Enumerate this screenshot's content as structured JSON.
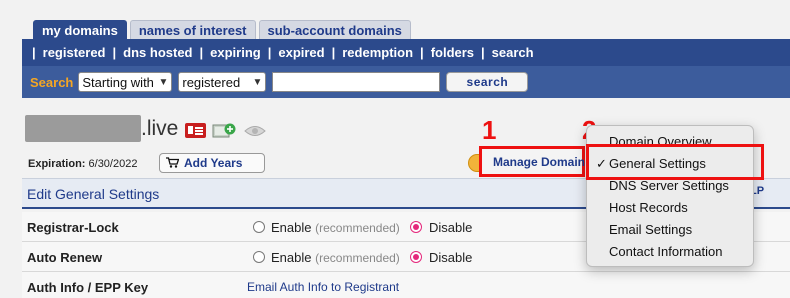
{
  "tabs": [
    {
      "label": "my domains",
      "active": true
    },
    {
      "label": "names of interest",
      "active": false
    },
    {
      "label": "sub-account domains",
      "active": false
    }
  ],
  "nav": {
    "separator": "|",
    "links": [
      "registered",
      "dns hosted",
      "expiring",
      "expired",
      "redemption",
      "folders",
      "search"
    ]
  },
  "search": {
    "label": "Search",
    "mode_value": "Starting with",
    "scope_value": "registered",
    "query_value": "",
    "button_label": "search"
  },
  "domain": {
    "suffix": ".live",
    "expiration_label": "Expiration:",
    "expiration_value": "6/30/2022",
    "add_years_label": "Add Years"
  },
  "annotations": {
    "step1": "1",
    "step2": "2"
  },
  "manage_domain_label": "Manage Domain",
  "settings": {
    "title": "Edit General Settings",
    "lp_peek": "LP",
    "rows": {
      "registrar_lock": {
        "label": "Registrar-Lock",
        "enable": "Enable",
        "enable_note": "(recommended)",
        "disable": "Disable",
        "selected": "disable"
      },
      "auto_renew": {
        "label": "Auto Renew",
        "enable": "Enable",
        "enable_note": "(recommended)",
        "disable": "Disable",
        "selected": "disable"
      },
      "auth_info": {
        "label": "Auth Info / EPP Key",
        "link": "Email Auth Info to Registrant"
      }
    }
  },
  "menu": {
    "check_mark": "✓",
    "items": [
      "Domain Overview",
      "General Settings",
      "DNS Server Settings",
      "Host Records",
      "Email Settings",
      "Contact Information"
    ],
    "selected_index": 1
  },
  "colors": {
    "nav_blue": "#2c4a8c",
    "search_label": "#f5a623",
    "annotation_red": "#ee1111",
    "radio_pink": "#e4277b"
  }
}
